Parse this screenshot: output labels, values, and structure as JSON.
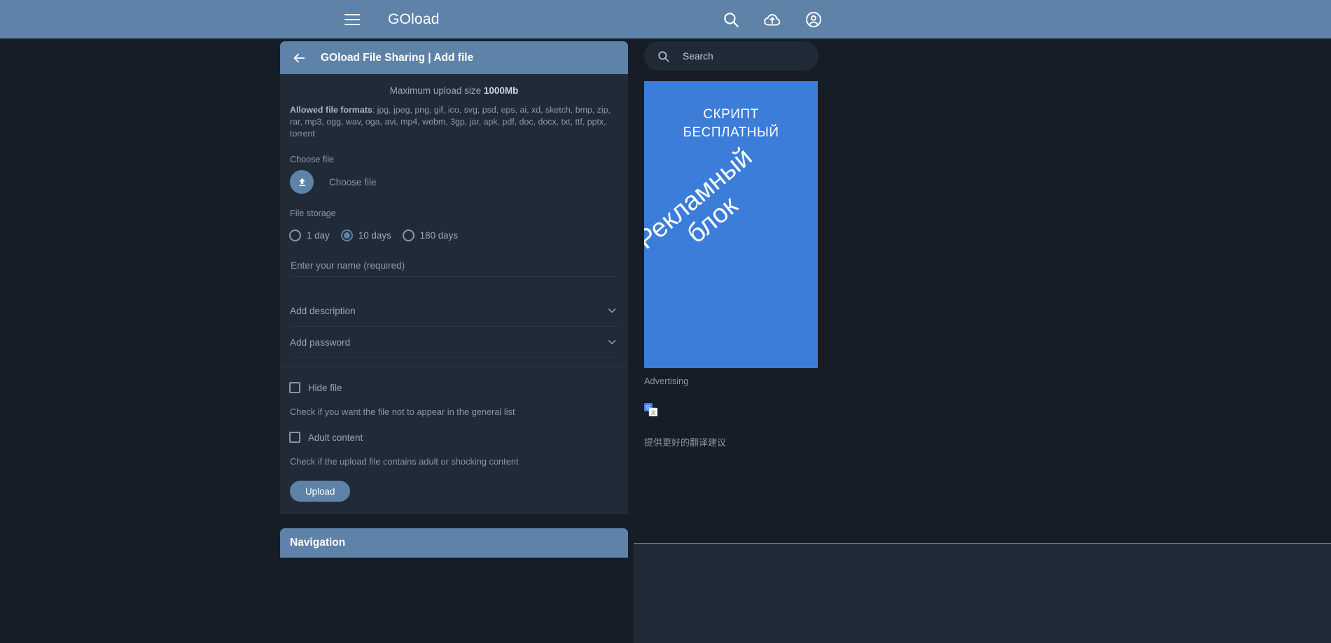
{
  "appbar": {
    "menu_icon": "hamburger-menu-icon",
    "title": "GOload",
    "icons": [
      "search-icon",
      "cloud-upload-icon",
      "account-circle-icon"
    ]
  },
  "page": {
    "back_icon": "arrow-left-icon",
    "header_title": "GOload File Sharing | Add file",
    "max_upload_prefix": "Maximum upload size ",
    "max_upload_value": "1000Mb",
    "formats_label": "Allowed file formats",
    "formats_value": ": jpg, jpeg, png, gif, ico, svg, psd, eps, ai, xd, sketch, bmp, zip, rar, mp3, ogg, wav, oga, avi, mp4, webm, 3gp, jar, apk, pdf, doc, docx, txt, ttf, pptx, torrent",
    "choose_file_label": "Choose file",
    "choose_file_button": "Choose file",
    "upload_icon": "upload-arrow-icon",
    "file_storage_label": "File storage",
    "storage_options": [
      {
        "label": "1 day",
        "selected": false
      },
      {
        "label": "10 days",
        "selected": true
      },
      {
        "label": "180 days",
        "selected": false
      }
    ],
    "name_placeholder": "Enter your name (required)",
    "name_value": "",
    "accordions": [
      {
        "label": "Add description",
        "icon": "chevron-down-icon"
      },
      {
        "label": "Add password",
        "icon": "chevron-down-icon"
      }
    ],
    "checkboxes": [
      {
        "label": "Hide file",
        "checked": false,
        "hint": "Check if you want the file not to appear in the general list"
      },
      {
        "label": "Adult content",
        "checked": false,
        "hint": "Check if the upload file contains adult or shocking content"
      }
    ],
    "upload_button": "Upload",
    "navigation_title": "Navigation"
  },
  "sidebar": {
    "search_icon": "search-icon",
    "search_placeholder": "Search",
    "search_value": "",
    "ad": {
      "line1": "СКРИПТ",
      "line2": "БЕСПЛАТНЫЙ",
      "diagonal1": "Рекламный",
      "diagonal2": "блок",
      "caption": "Advertising",
      "bg_color": "#3b7dd8"
    },
    "translate_icon": "google-translate-icon",
    "translate_suggest": "提供更好的翻译建议"
  },
  "colors": {
    "accent": "#5f82a8",
    "page_bg": "#161d26",
    "card_bg": "#212b38"
  }
}
